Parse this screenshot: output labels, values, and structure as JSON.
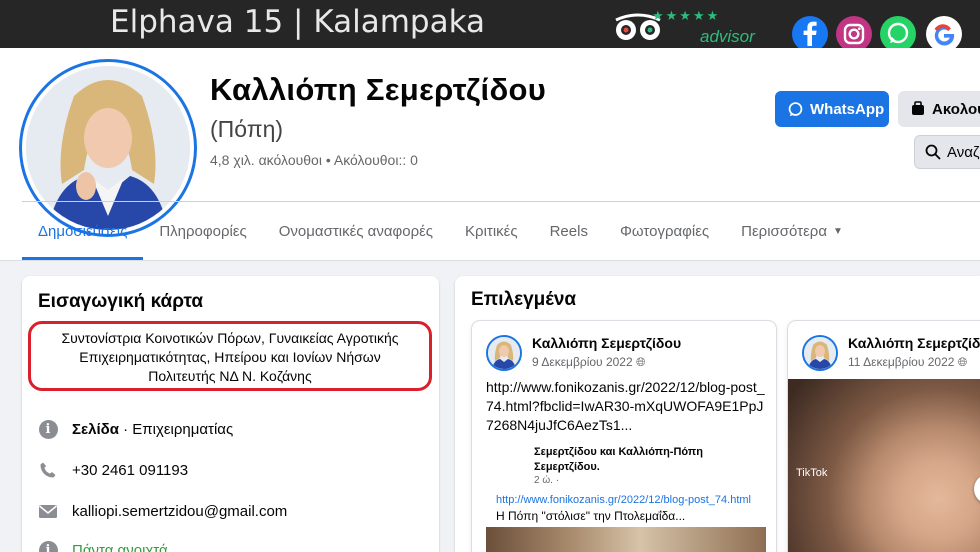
{
  "cover": {
    "title": "Elphava 15 | Kalampaka",
    "tripadvisor_word": "advisor",
    "tripadvisor_stars": "★★★★★",
    "social_icons": [
      "facebook-icon",
      "instagram-icon",
      "whatsapp-icon",
      "google-icon"
    ]
  },
  "profile": {
    "name": "Καλλιόπη Σεμερτζίδου",
    "nickname": "(Πόπη)",
    "followers": "4,8 χιλ. ακόλουθοι • Ακόλουθοι:: 0"
  },
  "actions": {
    "whatsapp": "WhatsApp",
    "follow": "Ακολου",
    "search": "Αναζ"
  },
  "tabs": [
    {
      "label": "Δημοσιεύσεις",
      "active": true
    },
    {
      "label": "Πληροφορίες"
    },
    {
      "label": "Ονομαστικές αναφορές"
    },
    {
      "label": "Κριτικές"
    },
    {
      "label": "Reels"
    },
    {
      "label": "Φωτογραφίες"
    },
    {
      "label": "Περισσότερα"
    }
  ],
  "intro": {
    "title": "Εισαγωγική κάρτα",
    "bio_line1": "Συντονίστρια Κοινοτικών Πόρων, Γυναικείας Αγροτικής",
    "bio_line2": "Επιχειρηματικότητας, Ηπείρου και Ιονίων Νήσων",
    "bio_line3": "Πολιτευτής ΝΔ Ν. Κοζάνης",
    "page_label": "Σελίδα",
    "page_category": " · Επιχειρηματίας",
    "phone": "+30 2461 091193",
    "email": "kalliopi.semertzidou@gmail.com",
    "hours": "Πάντα ανοιχτά"
  },
  "featured": {
    "title": "Επιλεγμένα",
    "cards": [
      {
        "author": "Καλλιόπη Σεμερτζίδου",
        "date": "9 Δεκεμβρίου 2022",
        "text": "http://www.fonikozanis.gr/2022/12/blog-post_74.html?fbclid=IwAR30-mXqUWOFA9E1PpJ7268N4juJfC6AezTs1...",
        "shared_names": "Σεμερτζίδου και Καλλιόπη-Πόπη Σεμερτζίδου.",
        "shared_meta": "2 ώ. ·",
        "link": "http://www.fonikozanis.gr/2022/12/blog-post_74.html",
        "caption": "Η Πόπη \"στόλισε\" την Πτολεμαΐδα..."
      },
      {
        "author": "Καλλιόπη Σεμερτζίδου",
        "date": "11 Δεκεμβρίου 2022",
        "overlay": "TikTok"
      }
    ]
  },
  "colors": {
    "accent": "#1b74e4",
    "highlight_border": "#d9202c",
    "page_bg": "#f0f2f5",
    "cover_bg": "#262626"
  }
}
